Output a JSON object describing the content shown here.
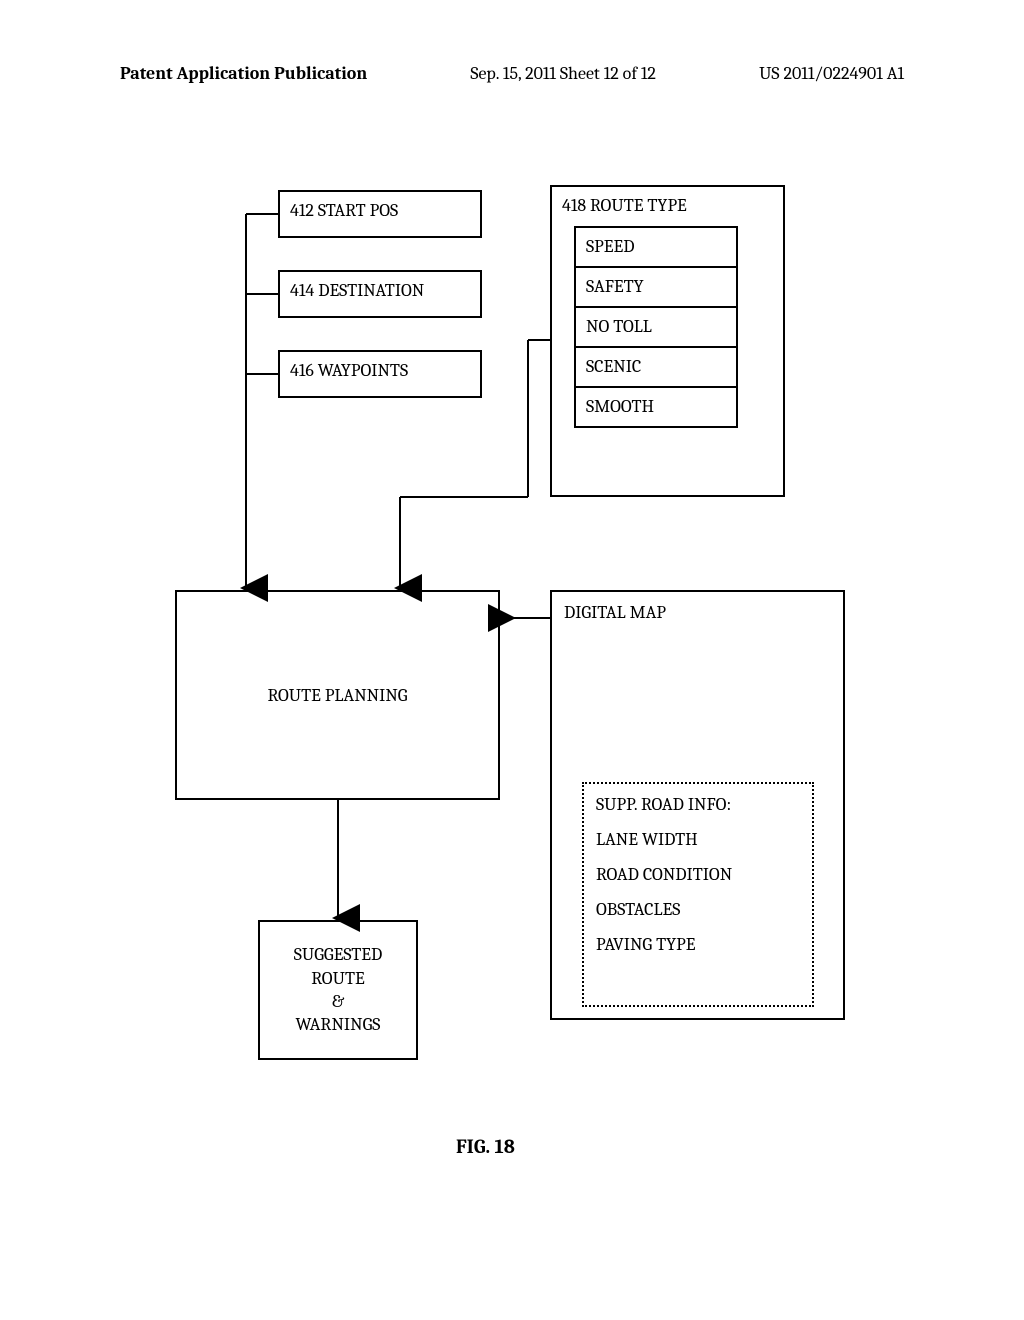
{
  "header": {
    "left": "Patent Application Publication",
    "mid": "Sep. 15, 2011  Sheet 12 of 12",
    "right": "US 2011/0224901 A1"
  },
  "inputs": {
    "start_pos": "412 START POS",
    "destination": "414 DESTINATION",
    "waypoints": "416 WAYPOINTS"
  },
  "route_type": {
    "title": "418 ROUTE TYPE",
    "items": [
      "SPEED",
      "SAFETY",
      "NO TOLL",
      "SCENIC",
      "SMOOTH"
    ]
  },
  "route_planning": "ROUTE PLANNING",
  "digital_map": {
    "title": "DIGITAL MAP",
    "supp_title": "SUPP. ROAD INFO:",
    "supp_items": [
      "LANE WIDTH",
      "ROAD CONDITION",
      "OBSTACLES",
      "PAVING TYPE"
    ]
  },
  "output": "SUGGESTED\nROUTE\n&\nWARNINGS",
  "figure_label": "FIG. 18"
}
